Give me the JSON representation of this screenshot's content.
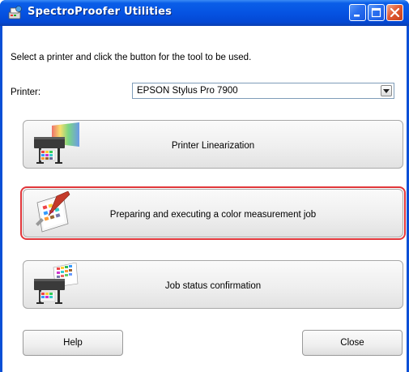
{
  "window": {
    "title": "SpectroProofer Utilities",
    "title_bar_color": "#0553e2",
    "controls": [
      "minimize-icon",
      "maximize-icon",
      "close-icon"
    ]
  },
  "instruction": "Select a printer and click the button for the tool to be used.",
  "printer": {
    "label": "Printer:",
    "selected": "EPSON Stylus Pro 7900"
  },
  "tools": [
    {
      "label": "Printer Linearization",
      "icon": "printer-linearization-icon"
    },
    {
      "label": "Preparing and executing a color measurement job",
      "icon": "color-measurement-icon",
      "focused": true
    },
    {
      "label": "Job status confirmation",
      "icon": "job-status-icon"
    }
  ],
  "footer": {
    "help_label": "Help",
    "close_label": "Close"
  },
  "colors": {
    "focus_ring": "#e0363a",
    "close_button": "#e05a34"
  }
}
